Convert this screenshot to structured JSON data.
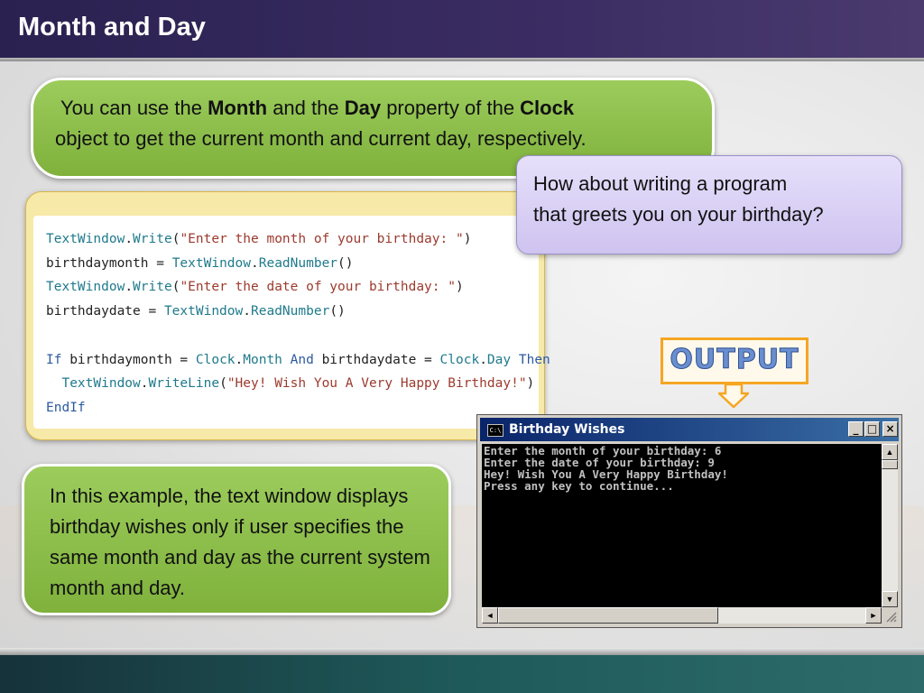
{
  "header": {
    "title": "Month and Day"
  },
  "intro": {
    "t1": "You can use the ",
    "b1": "Month",
    "t2": " and the ",
    "b2": "Day",
    "t3": " property of the ",
    "b3": "Clock",
    "t4": "object to get the current month and current day, respectively."
  },
  "question": {
    "line1": "How about writing a program",
    "line2": "that greets you on your birthday?"
  },
  "code": {
    "line1": {
      "a": "TextWindow",
      "b": ".",
      "c": "Write",
      "d": "(",
      "e": "\"Enter the month of your birthday: \"",
      "f": ")"
    },
    "line2": {
      "a": "birthdaymonth = ",
      "b": "TextWindow",
      "c": ".",
      "d": "ReadNumber",
      "e": "()"
    },
    "line3": {
      "a": "TextWindow",
      "b": ".",
      "c": "Write",
      "d": "(",
      "e": "\"Enter the date of your birthday: \"",
      "f": ")"
    },
    "line4": {
      "a": "birthdaydate = ",
      "b": "TextWindow",
      "c": ".",
      "d": "ReadNumber",
      "e": "()"
    },
    "line5": {
      "a": "If",
      "b": " birthdaymonth = ",
      "c": "Clock",
      "d": ".",
      "e": "Month",
      "f": " And",
      "g": " birthdaydate = ",
      "h": "Clock",
      "i": ".",
      "j": "Day",
      "k": " Then"
    },
    "line6": {
      "a": "  TextWindow",
      "b": ".",
      "c": "WriteLine",
      "d": "(",
      "e": "\"Hey! Wish You A Very Happy Birthday!\"",
      "f": ")"
    },
    "line7": {
      "a": "EndIf"
    }
  },
  "output_label": "OUTPUT",
  "console": {
    "title": "Birthday Wishes",
    "icon_text": "C:\\",
    "minimize": "_",
    "maximize": "□",
    "close": "×",
    "lines": [
      "Enter the month of your birthday: 6",
      "Enter the date of your birthday: 9",
      "Hey! Wish You A Very Happy Birthday!",
      "Press any key to continue..."
    ],
    "scroll_up": "▲",
    "scroll_down": "▼",
    "scroll_left": "◄",
    "scroll_right": "►"
  },
  "explanation": "In this example, the text window displays birthday wishes only if user specifies the same month and day as the current system month and day.",
  "colors": {
    "header": "#2a2150",
    "green_callout": "#8cbf4a",
    "purple_callout": "#d9d0f5",
    "code_panel": "#f7e9a8",
    "output_border": "#f5a623",
    "console_title": "#0a246a"
  }
}
